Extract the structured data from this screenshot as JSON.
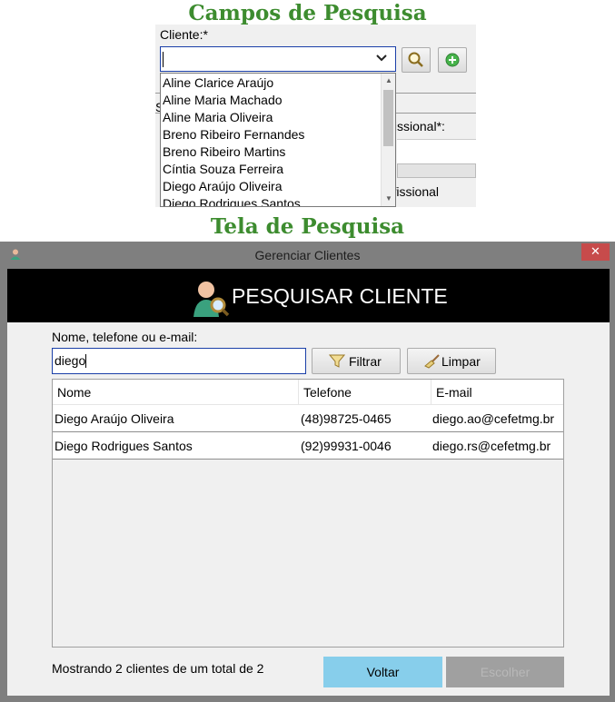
{
  "headings": {
    "top": "Campos de Pesquisa",
    "bottom": "Tela de Pesquisa"
  },
  "campos": {
    "cliente_label": "Cliente:*",
    "combo_value": "",
    "dropdown_items": [
      "Aline Clarice Araújo",
      "Aline Maria Machado",
      "Aline Maria Oliveira",
      "Breno Ribeiro Fernandes",
      "Breno Ribeiro Martins",
      "Cíntia Souza Ferreira",
      "Diego Araújo Oliveira",
      "Diego Rodrigues Santos"
    ],
    "background_text": {
      "s": "S",
      "profissional_label": "fissional*:",
      "profissional_text": "rofissional"
    }
  },
  "window": {
    "title": "Gerenciar Clientes",
    "close_glyph": "✕",
    "banner_title": "PESQUISAR CLIENTE",
    "filter": {
      "label": "Nome, telefone ou e-mail:",
      "value": "diego",
      "filter_button": "Filtrar",
      "clear_button": "Limpar"
    },
    "table": {
      "columns": [
        "Nome",
        "Telefone",
        "E-mail"
      ],
      "rows": [
        [
          "Diego Araújo Oliveira",
          "(48)98725-0465",
          "diego.ao@cefetmg.br"
        ],
        [
          "Diego Rodrigues Santos",
          "(92)99931-0046",
          "diego.rs@cefetmg.br"
        ]
      ]
    },
    "status_text": "Mostrando 2 clientes de um total de 2",
    "back_button": "Voltar",
    "choose_button": "Escolher"
  },
  "icons": {
    "combo": "chevron-down-icon",
    "search": "magnifier-icon",
    "add": "plus-circle-icon",
    "app": "user-icon",
    "banner": "user-search-icon",
    "filter": "funnel-icon",
    "clear": "broom-icon"
  },
  "colors": {
    "heading_green": "#3d8c2f",
    "focus_border": "#1a3fa8",
    "banner_bg": "#000000",
    "voltar_bg": "#87ceeb",
    "escolher_bg": "#a0a0a0",
    "close_bg": "#c74b4b"
  }
}
